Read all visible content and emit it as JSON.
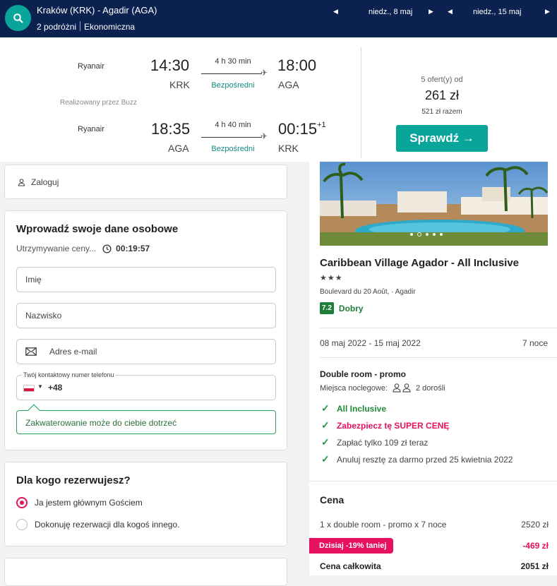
{
  "topbar": {
    "route": "Kraków (KRK) - Agadir (AGA)",
    "travelers": "2 podróżni",
    "cabin": "Ekonomiczna",
    "depart_date": "niedz., 8 maj",
    "return_date": "niedz., 15 maj"
  },
  "flights": {
    "outbound": {
      "airline": "Ryanair",
      "dep_time": "14:30",
      "dep_code": "KRK",
      "duration": "4 h 30 min",
      "stops": "Bezpośredni",
      "arr_time": "18:00",
      "arr_code": "AGA"
    },
    "operated_by": "Realizowany przez Buzz",
    "inbound": {
      "airline": "Ryanair",
      "dep_time": "18:35",
      "dep_code": "AGA",
      "duration": "4 h 40 min",
      "stops": "Bezpośredni",
      "arr_time": "00:15",
      "day_offset": "+1",
      "arr_code": "KRK"
    },
    "offers": "5 ofert(y) od",
    "price": "261 zł",
    "total": "521 zł razem",
    "check_label": "Sprawdź →"
  },
  "login": {
    "label": "Zaloguj"
  },
  "personal": {
    "title": "Wprowadź swoje dane osobowe",
    "hold_text": "Utrzymywanie ceny...",
    "timer": "00:19:57",
    "first_name_placeholder": "Imię",
    "last_name_placeholder": "Nazwisko",
    "email_placeholder": "Adres e-mail",
    "phone_label": "Twój kontaktowy numer telefonu",
    "phone_prefix": "+48",
    "hint": "Zakwaterowanie może do ciebie dotrzeć"
  },
  "booking_for": {
    "title": "Dla kogo rezerwujesz?",
    "options": [
      "Ja jestem głównym Gościem",
      "Dokonuję rezerwacji dla kogoś innego."
    ]
  },
  "hotel": {
    "name": "Caribbean Village Agador - All Inclusive",
    "stars": "★★★",
    "address": "Boulevard du 20 Août, · Agadir",
    "score": "7.2",
    "score_word": "Dobry",
    "dates": "08 maj 2022 - 15 maj 2022",
    "nights": "7 noce",
    "room": "Double room - promo",
    "beds_label": "Miejsca noclegowe:",
    "beds_value": "2 dorośli",
    "features": [
      "All Inclusive",
      "Zabezpiecz tę SUPER CENĘ",
      "Zapłać tylko 109 zł teraz",
      "Anuluj resztę za darmo przed 25 kwietnia 2022"
    ]
  },
  "price": {
    "title": "Cena",
    "item": "1 x double room - promo x 7 noce",
    "item_price": "2520 zł",
    "discount_label": "Dzisiaj -19% taniej",
    "discount_value": "-469 zł",
    "total_label": "Cena całkowita",
    "total_value": "2051 zł"
  },
  "colors": {
    "teal": "#0aa59a",
    "navy": "#0b2150",
    "pink": "#e5115f",
    "green": "#1f8a3a"
  }
}
